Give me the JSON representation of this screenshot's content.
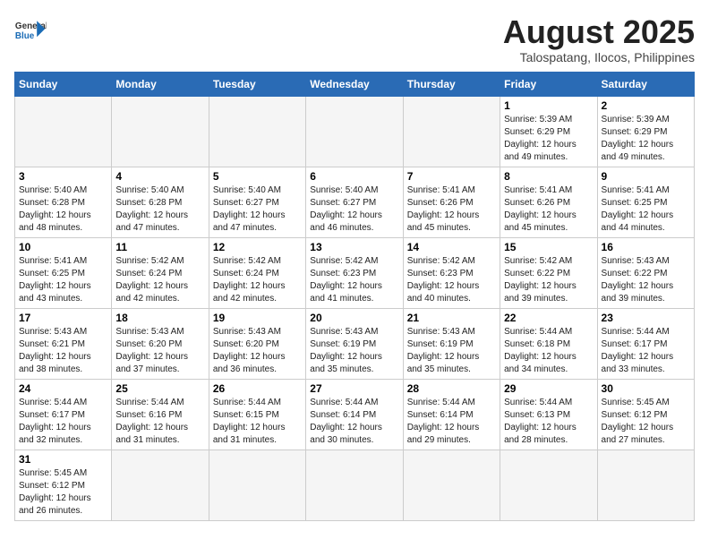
{
  "logo": {
    "general": "General",
    "blue": "Blue"
  },
  "title": "August 2025",
  "subtitle": "Talospatang, Ilocos, Philippines",
  "weekdays": [
    "Sunday",
    "Monday",
    "Tuesday",
    "Wednesday",
    "Thursday",
    "Friday",
    "Saturday"
  ],
  "weeks": [
    [
      {
        "day": "",
        "empty": true
      },
      {
        "day": "",
        "empty": true
      },
      {
        "day": "",
        "empty": true
      },
      {
        "day": "",
        "empty": true
      },
      {
        "day": "",
        "empty": true
      },
      {
        "day": "1",
        "sunrise": "5:39 AM",
        "sunset": "6:29 PM",
        "daylight": "12 hours and 49 minutes."
      },
      {
        "day": "2",
        "sunrise": "5:39 AM",
        "sunset": "6:29 PM",
        "daylight": "12 hours and 49 minutes."
      }
    ],
    [
      {
        "day": "3",
        "sunrise": "5:40 AM",
        "sunset": "6:28 PM",
        "daylight": "12 hours and 48 minutes."
      },
      {
        "day": "4",
        "sunrise": "5:40 AM",
        "sunset": "6:28 PM",
        "daylight": "12 hours and 47 minutes."
      },
      {
        "day": "5",
        "sunrise": "5:40 AM",
        "sunset": "6:27 PM",
        "daylight": "12 hours and 47 minutes."
      },
      {
        "day": "6",
        "sunrise": "5:40 AM",
        "sunset": "6:27 PM",
        "daylight": "12 hours and 46 minutes."
      },
      {
        "day": "7",
        "sunrise": "5:41 AM",
        "sunset": "6:26 PM",
        "daylight": "12 hours and 45 minutes."
      },
      {
        "day": "8",
        "sunrise": "5:41 AM",
        "sunset": "6:26 PM",
        "daylight": "12 hours and 45 minutes."
      },
      {
        "day": "9",
        "sunrise": "5:41 AM",
        "sunset": "6:25 PM",
        "daylight": "12 hours and 44 minutes."
      }
    ],
    [
      {
        "day": "10",
        "sunrise": "5:41 AM",
        "sunset": "6:25 PM",
        "daylight": "12 hours and 43 minutes."
      },
      {
        "day": "11",
        "sunrise": "5:42 AM",
        "sunset": "6:24 PM",
        "daylight": "12 hours and 42 minutes."
      },
      {
        "day": "12",
        "sunrise": "5:42 AM",
        "sunset": "6:24 PM",
        "daylight": "12 hours and 42 minutes."
      },
      {
        "day": "13",
        "sunrise": "5:42 AM",
        "sunset": "6:23 PM",
        "daylight": "12 hours and 41 minutes."
      },
      {
        "day": "14",
        "sunrise": "5:42 AM",
        "sunset": "6:23 PM",
        "daylight": "12 hours and 40 minutes."
      },
      {
        "day": "15",
        "sunrise": "5:42 AM",
        "sunset": "6:22 PM",
        "daylight": "12 hours and 39 minutes."
      },
      {
        "day": "16",
        "sunrise": "5:43 AM",
        "sunset": "6:22 PM",
        "daylight": "12 hours and 39 minutes."
      }
    ],
    [
      {
        "day": "17",
        "sunrise": "5:43 AM",
        "sunset": "6:21 PM",
        "daylight": "12 hours and 38 minutes."
      },
      {
        "day": "18",
        "sunrise": "5:43 AM",
        "sunset": "6:20 PM",
        "daylight": "12 hours and 37 minutes."
      },
      {
        "day": "19",
        "sunrise": "5:43 AM",
        "sunset": "6:20 PM",
        "daylight": "12 hours and 36 minutes."
      },
      {
        "day": "20",
        "sunrise": "5:43 AM",
        "sunset": "6:19 PM",
        "daylight": "12 hours and 35 minutes."
      },
      {
        "day": "21",
        "sunrise": "5:43 AM",
        "sunset": "6:19 PM",
        "daylight": "12 hours and 35 minutes."
      },
      {
        "day": "22",
        "sunrise": "5:44 AM",
        "sunset": "6:18 PM",
        "daylight": "12 hours and 34 minutes."
      },
      {
        "day": "23",
        "sunrise": "5:44 AM",
        "sunset": "6:17 PM",
        "daylight": "12 hours and 33 minutes."
      }
    ],
    [
      {
        "day": "24",
        "sunrise": "5:44 AM",
        "sunset": "6:17 PM",
        "daylight": "12 hours and 32 minutes."
      },
      {
        "day": "25",
        "sunrise": "5:44 AM",
        "sunset": "6:16 PM",
        "daylight": "12 hours and 31 minutes."
      },
      {
        "day": "26",
        "sunrise": "5:44 AM",
        "sunset": "6:15 PM",
        "daylight": "12 hours and 31 minutes."
      },
      {
        "day": "27",
        "sunrise": "5:44 AM",
        "sunset": "6:14 PM",
        "daylight": "12 hours and 30 minutes."
      },
      {
        "day": "28",
        "sunrise": "5:44 AM",
        "sunset": "6:14 PM",
        "daylight": "12 hours and 29 minutes."
      },
      {
        "day": "29",
        "sunrise": "5:44 AM",
        "sunset": "6:13 PM",
        "daylight": "12 hours and 28 minutes."
      },
      {
        "day": "30",
        "sunrise": "5:45 AM",
        "sunset": "6:12 PM",
        "daylight": "12 hours and 27 minutes."
      }
    ],
    [
      {
        "day": "31",
        "sunrise": "5:45 AM",
        "sunset": "6:12 PM",
        "daylight": "12 hours and 26 minutes."
      },
      {
        "day": "",
        "empty": true
      },
      {
        "day": "",
        "empty": true
      },
      {
        "day": "",
        "empty": true
      },
      {
        "day": "",
        "empty": true
      },
      {
        "day": "",
        "empty": true
      },
      {
        "day": "",
        "empty": true
      }
    ]
  ]
}
